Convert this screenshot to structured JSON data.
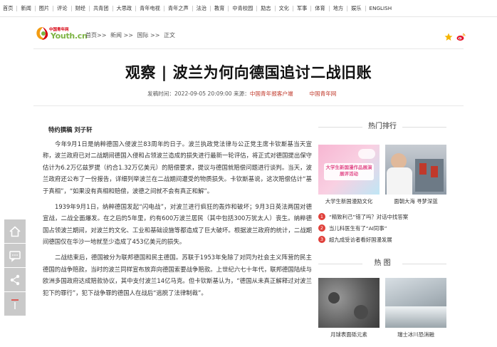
{
  "topnav": [
    "首页",
    "新闻",
    "图片",
    "评论",
    "财经",
    "共青团",
    "大思政",
    "青年电视",
    "青年之声",
    "法治",
    "教育",
    "中青校园",
    "励志",
    "文化",
    "军事",
    "体育",
    "地方",
    "娱乐",
    "ENGLISH"
  ],
  "logo": {
    "small": "中国青年网",
    "main": "Youth.cn"
  },
  "breadcrumb": [
    "首页>>",
    "新闻 >>",
    "国际 >>",
    "正文"
  ],
  "title": "观察 | 波兰为何向德国追讨二战旧账",
  "meta": {
    "time_label": "发稿时间：",
    "time": "2022-09-05 20:09:00",
    "source_label": "来源：",
    "source": "中国青年报客户端",
    "site": "中国青年网"
  },
  "byline": "特约撰稿 刘子轩",
  "paragraphs": [
    "今年9月1日是纳粹德国入侵波兰83周年的日子。波兰执政党法律与公正党主席卡钦斯基当天宣称，波兰政府已对二战期间德国入侵和占领波兰造成的损失进行最新一轮评估，将正式对德国提出保守估计为6.2万亿兹罗提（约合1.32万亿美元）的赔偿要求，提议与德国就赔偿问题进行谈判。当天，波兰政府还公布了一份报告，详细列举波兰在二战期间遭受的物质损失。卡钦斯基说，这次赔偿估计“基于真相”，“如果没有真相和赔偿，波德之间就不会有真正和解”。",
    "1939年9月1日，纳粹德国发起“闪电战”，对波兰进行疯狂的轰炸和破坏；9月3日英法两国对德宣战，二战全面爆发。在之后的5年里，约有600万波兰居民（其中包括300万犹太人）丧生。纳粹德国占领波兰期间，对波兰的文化、工业和基础设施等都造成了巨大破坏。根据波兰政府的统计，二战期间德国仅在华沙一地就至少造成了453亿美元的损失。",
    "二战结束后，德国被分为联邦德国和民主德国。苏联于1953年免除了对同为社会主义阵营的民主德国的战争赔款，当时的波兰同样宣布放弃向德国索要战争赔款。上世纪六七十年代，联邦德国陆续与欧洲多国政府达成赔款协议，其中支付波兰14亿马克。但卡钦斯基认为，“德国从未真正解释过对波兰犯下的罪行”，犯下战争罪的德国人在战后“逃脱了法律制裁”。"
  ],
  "sidebar_buttons": [
    "home-icon",
    "comment-icon",
    "share-icon",
    "top-icon"
  ],
  "hot_rank": {
    "title": "热门排行",
    "thumbs": [
      {
        "caption": "大学生新国漫励文化",
        "overlay": "大学生新国漫作品展演展评活动"
      },
      {
        "caption": "面朝大海 寻梦深蓝"
      }
    ],
    "list": [
      {
        "num": "1",
        "text": "“精致利己”错了吗？对话中找答案"
      },
      {
        "num": "2",
        "text": "当儿科医生有了“AI同事”"
      },
      {
        "num": "3",
        "text": "超九成受访者看好国漫发展"
      }
    ]
  },
  "hot_pics": {
    "title": "热  图",
    "thumbs": [
      {
        "caption": "月球表面砾元素"
      },
      {
        "caption": "瑞士冰川恐消融"
      }
    ]
  },
  "colors": {
    "accent_red": "#e0403a",
    "logo_green": "#7cb342",
    "brand_red": "#d7000f"
  }
}
